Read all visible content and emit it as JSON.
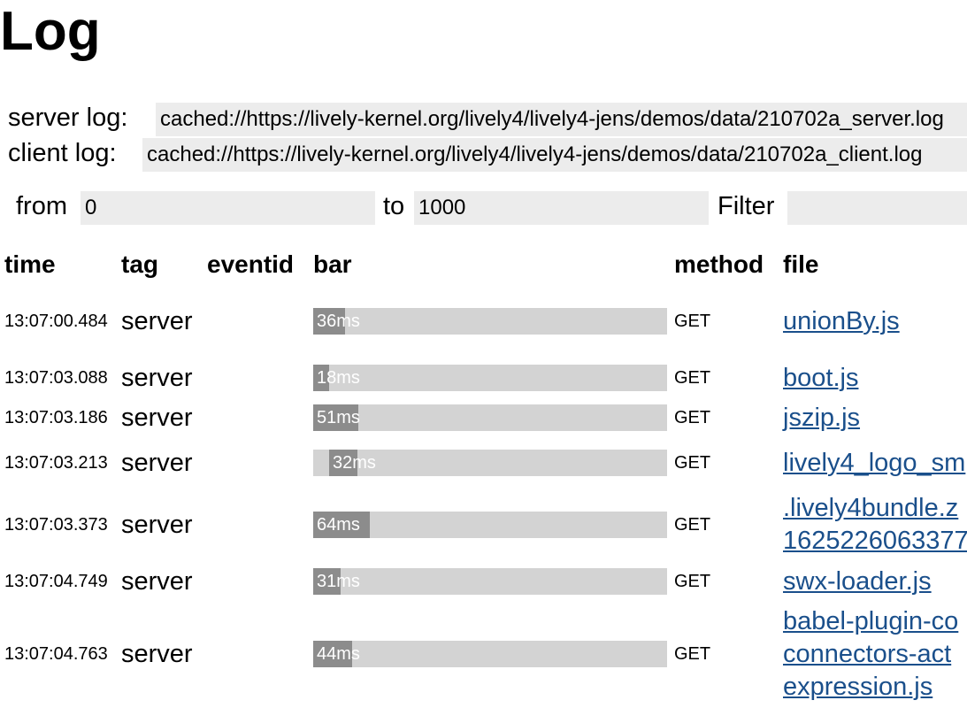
{
  "page": {
    "title": "Log"
  },
  "form": {
    "server_log_label": "server log:",
    "server_log_value": "cached://https://lively-kernel.org/lively4/lively4-jens/demos/data/210702a_server.log",
    "client_log_label": "client log:",
    "client_log_value": "cached://https://lively-kernel.org/lively4/lively4-jens/demos/data/210702a_client.log",
    "from_label": "from",
    "from_value": "0",
    "to_label": "to",
    "to_value": "1000",
    "filter_label": "Filter",
    "filter_value": ""
  },
  "table": {
    "columns": [
      "time",
      "tag",
      "eventid",
      "bar",
      "method",
      "file"
    ],
    "rows": [
      {
        "time": "13:07:00.484",
        "tag": "server",
        "eventid": "",
        "bar_start": 0,
        "bar_duration": 36,
        "bar_label": "36ms",
        "method": "GET",
        "file": [
          "unionBy.js"
        ]
      },
      {
        "time": "13:07:03.088",
        "tag": "server",
        "eventid": "",
        "bar_start": 0,
        "bar_duration": 18,
        "bar_label": "18ms",
        "method": "GET",
        "file": [
          "boot.js"
        ]
      },
      {
        "time": "13:07:03.186",
        "tag": "server",
        "eventid": "",
        "bar_start": 0,
        "bar_duration": 51,
        "bar_label": "51ms",
        "method": "GET",
        "file": [
          "jszip.js"
        ]
      },
      {
        "time": "13:07:03.213",
        "tag": "server",
        "eventid": "",
        "bar_start": 18,
        "bar_duration": 32,
        "bar_label": "32ms",
        "method": "GET",
        "file": [
          "lively4_logo_sm"
        ]
      },
      {
        "time": "13:07:03.373",
        "tag": "server",
        "eventid": "",
        "bar_start": 0,
        "bar_duration": 64,
        "bar_label": "64ms",
        "method": "GET",
        "file": [
          ".lively4bundle.z",
          "1625226063377"
        ]
      },
      {
        "time": "13:07:04.749",
        "tag": "server",
        "eventid": "",
        "bar_start": 0,
        "bar_duration": 31,
        "bar_label": "31ms",
        "method": "GET",
        "file": [
          "swx-loader.js"
        ]
      },
      {
        "time": "13:07:04.763",
        "tag": "server",
        "eventid": "",
        "bar_start": 0,
        "bar_duration": 44,
        "bar_label": "44ms",
        "method": "GET",
        "file": [
          "babel-plugin-co",
          "connectors-act",
          "expression.js"
        ]
      }
    ]
  },
  "bar_scale_ms": 400,
  "colors": {
    "bar_track": "#d3d3d3",
    "bar_fill": "#8c8c8c",
    "link": "#1a4f8b",
    "input_bg": "#ececec"
  }
}
